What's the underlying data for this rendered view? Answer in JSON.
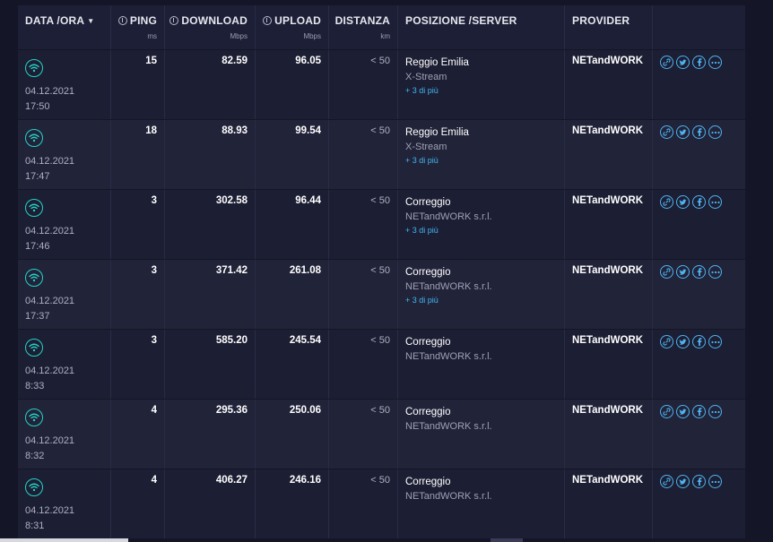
{
  "header": {
    "date": "DATA /ORA",
    "ping": "PING",
    "ping_unit": "ms",
    "download": "DOWNLOAD",
    "download_unit": "Mbps",
    "upload": "UPLOAD",
    "upload_unit": "Mbps",
    "distance": "DISTANZA",
    "distance_unit": "km",
    "position": "POSIZIONE /SERVER",
    "provider": "PROVIDER"
  },
  "rows": [
    {
      "date": "04.12.2021",
      "time": "17:50",
      "ping": "15",
      "download": "82.59",
      "upload": "96.05",
      "distance": "< 50",
      "city": "Reggio Emilia",
      "server": "X-Stream",
      "more": "+ 3 di più",
      "provider": "NETandWORK"
    },
    {
      "date": "04.12.2021",
      "time": "17:47",
      "ping": "18",
      "download": "88.93",
      "upload": "99.54",
      "distance": "< 50",
      "city": "Reggio Emilia",
      "server": "X-Stream",
      "more": "+ 3 di più",
      "provider": "NETandWORK"
    },
    {
      "date": "04.12.2021",
      "time": "17:46",
      "ping": "3",
      "download": "302.58",
      "upload": "96.44",
      "distance": "< 50",
      "city": "Correggio",
      "server": "NETandWORK s.r.l.",
      "more": "+ 3 di più",
      "provider": "NETandWORK"
    },
    {
      "date": "04.12.2021",
      "time": "17:37",
      "ping": "3",
      "download": "371.42",
      "upload": "261.08",
      "distance": "< 50",
      "city": "Correggio",
      "server": "NETandWORK s.r.l.",
      "more": "+ 3 di più",
      "provider": "NETandWORK"
    },
    {
      "date": "04.12.2021",
      "time": "8:33",
      "ping": "3",
      "download": "585.20",
      "upload": "245.54",
      "distance": "< 50",
      "city": "Correggio",
      "server": "NETandWORK s.r.l.",
      "more": "",
      "provider": "NETandWORK"
    },
    {
      "date": "04.12.2021",
      "time": "8:32",
      "ping": "4",
      "download": "295.36",
      "upload": "250.06",
      "distance": "< 50",
      "city": "Correggio",
      "server": "NETandWORK s.r.l.",
      "more": "",
      "provider": "NETandWORK"
    },
    {
      "date": "04.12.2021",
      "time": "8:31",
      "ping": "4",
      "download": "406.27",
      "upload": "246.16",
      "distance": "< 50",
      "city": "Correggio",
      "server": "NETandWORK s.r.l.",
      "more": "",
      "provider": "NETandWORK"
    }
  ],
  "icons": {
    "result": "wifi-icon",
    "share": [
      "link-icon",
      "twitter-icon",
      "facebook-icon",
      "more-icon"
    ]
  },
  "colors": {
    "background": "#141526",
    "row": "#1c1e33",
    "row_alt": "#212339",
    "wifi": "#26d2c5",
    "share": "#4fb3ef",
    "more_link": "#43b6f0"
  }
}
